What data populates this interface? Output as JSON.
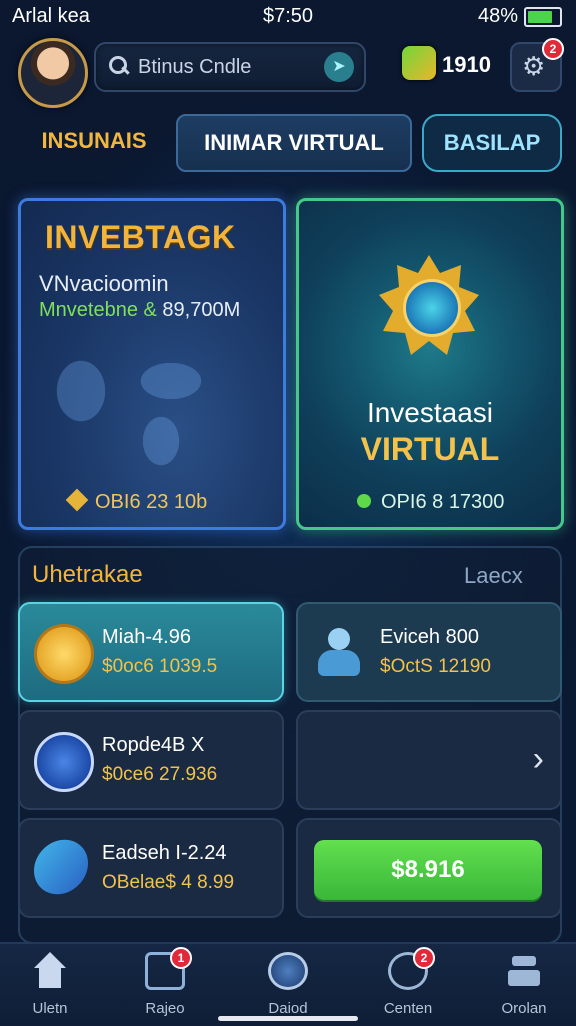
{
  "status_bar": {
    "carrier": "Arlal kea",
    "time": "$7:50",
    "battery": "48%"
  },
  "header": {
    "search_text": "Btinus Cndle",
    "coins": "1910",
    "notification_count": "2"
  },
  "tabs": [
    {
      "label": "INSUNAIS"
    },
    {
      "label": "INIMAR VIRTUAL"
    },
    {
      "label": "BASILAP"
    }
  ],
  "card_left": {
    "title": "INVEBTAGK",
    "subtitle": "VNvacioomin",
    "line_green": "Mnvetebne &",
    "line_white": "89,700M",
    "footer": "OBI6 23 10b"
  },
  "card_right": {
    "title_line1": "Investaasi",
    "title_line2": "VIRTUAL",
    "footer": "OPI6 8 17300"
  },
  "list": {
    "title": "Uhetrakae",
    "link": "Laecx",
    "items": [
      {
        "name": "Miah-4.96",
        "value": "$0oc6 1039.5"
      },
      {
        "name": "Eviceh 800",
        "value": "$OctS 12190"
      },
      {
        "name": "Ropde4B X",
        "value": "$0ce6 27.936"
      },
      {
        "name": "",
        "value": ""
      },
      {
        "name": "Eadseh I-2.24",
        "value": "OBelae$ 4 8.99"
      }
    ],
    "buy_button": "$8.916"
  },
  "nav": [
    {
      "label": "Uletn",
      "badge": ""
    },
    {
      "label": "Rajeo",
      "badge": "1"
    },
    {
      "label": "Daiod",
      "badge": ""
    },
    {
      "label": "Centen",
      "badge": "2"
    },
    {
      "label": "Orolan",
      "badge": ""
    }
  ]
}
